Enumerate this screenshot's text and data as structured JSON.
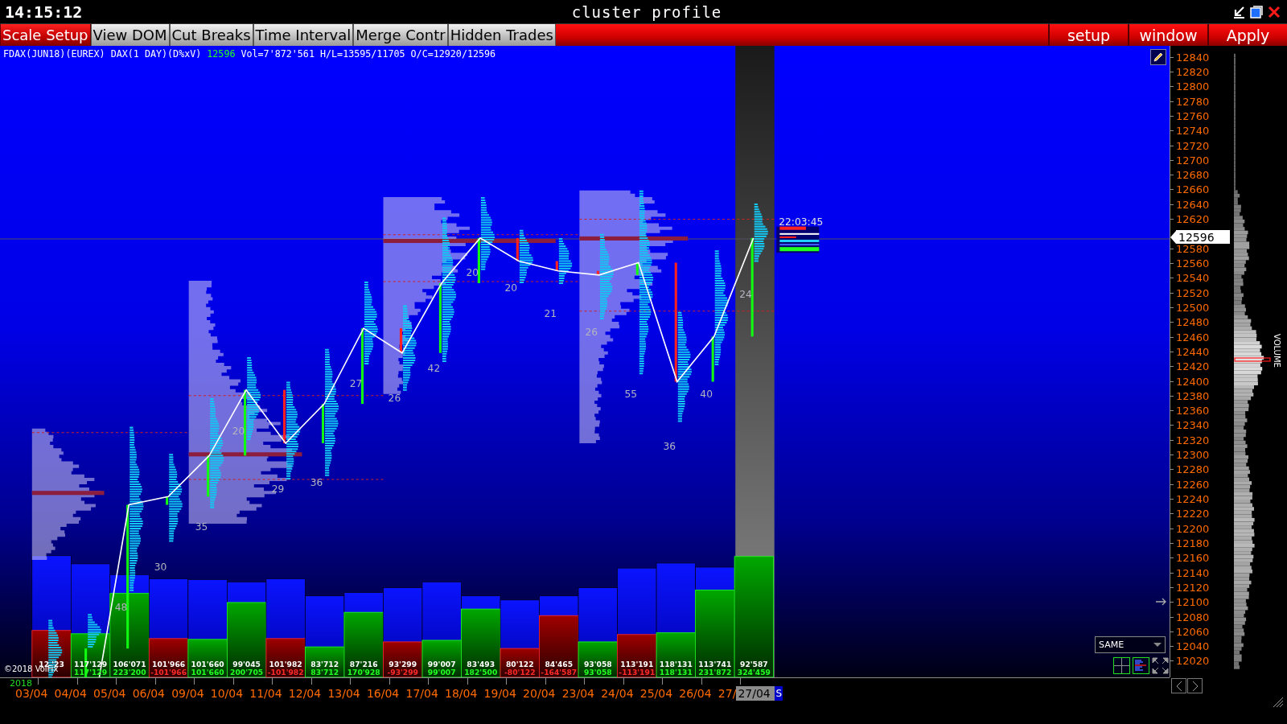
{
  "window": {
    "clock": "14:15:12",
    "title": "cluster profile"
  },
  "toolbar": {
    "left": [
      {
        "label": "Scale Setup",
        "selected": true
      },
      {
        "label": "View DOM",
        "selected": false
      },
      {
        "label": "Cut Breaks",
        "selected": false
      },
      {
        "label": "Time Interval",
        "selected": false
      },
      {
        "label": "Merge Contr",
        "selected": false
      },
      {
        "label": "Hidden Trades",
        "selected": false
      }
    ],
    "right": [
      "setup",
      "window",
      "Apply"
    ]
  },
  "chart": {
    "instrument": "FDAX(JUN18)(EUREX) DAX(1 DAY)(D%xV)",
    "last": "12596",
    "stats": "Vol=7'872'561 H/L=13595/11705 O/C=12920/12596",
    "last_time": "22:03:45",
    "copyright": "©2018 VolFix",
    "view_mode": "SAME",
    "days": [
      {
        "volume": "12 '23",
        "level": 0.925,
        "delta": {
          "negative": true,
          "level": 0.356
        }
      },
      {
        "volume": "117'129",
        "level": 0.863,
        "delta": {
          "label": "117'129",
          "negative": false,
          "level": 0.331
        }
      },
      {
        "volume": "106'071",
        "level": 0.781,
        "delta": {
          "label": "223'200",
          "negative": false,
          "level": 0.638
        },
        "cluster_label": "48"
      },
      {
        "volume": "101'966",
        "level": 0.75,
        "delta": {
          "label": "-101'966",
          "negative": true,
          "level": 0.294
        },
        "cluster_label": "30"
      },
      {
        "volume": "101'660",
        "level": 0.744,
        "delta": {
          "label": "101'660",
          "negative": false,
          "level": 0.288
        },
        "cluster_label": "35"
      },
      {
        "volume": "99'045",
        "level": 0.725,
        "delta": {
          "label": "200'705",
          "negative": false,
          "level": 0.569
        },
        "cluster_label": "20"
      },
      {
        "volume": "101'982",
        "level": 0.75,
        "delta": {
          "label": "-101'982",
          "negative": true,
          "level": 0.294
        },
        "cluster_label": "29"
      },
      {
        "volume": "83'712",
        "level": 0.619,
        "delta": {
          "label": "83'712",
          "negative": false,
          "level": 0.231
        },
        "cluster_label": "36"
      },
      {
        "volume": "87'216",
        "level": 0.644,
        "delta": {
          "label": "170'928",
          "negative": false,
          "level": 0.494
        },
        "cluster_label": "27"
      },
      {
        "volume": "93'299",
        "level": 0.681,
        "delta": {
          "label": "-93'299",
          "negative": true,
          "level": 0.269
        },
        "cluster_label": "26"
      },
      {
        "volume": "99'007",
        "level": 0.725,
        "delta": {
          "label": "99'007",
          "negative": false,
          "level": 0.281
        },
        "cluster_label": "42"
      },
      {
        "volume": "83'493",
        "level": 0.619,
        "delta": {
          "label": "182'500",
          "negative": false,
          "level": 0.519
        },
        "cluster_label": "20"
      },
      {
        "volume": "80'122",
        "level": 0.588,
        "delta": {
          "label": "-80'122",
          "negative": true,
          "level": 0.219
        },
        "cluster_label": "20"
      },
      {
        "volume": "84'465",
        "level": 0.619,
        "delta": {
          "label": "-164'587",
          "negative": true,
          "level": 0.469
        },
        "cluster_label": "21"
      },
      {
        "volume": "93'058",
        "level": 0.681,
        "delta": {
          "label": "93'058",
          "negative": false,
          "level": 0.269
        },
        "cluster_label": "26"
      },
      {
        "volume": "113'191",
        "level": 0.831,
        "delta": {
          "label": "-113'191",
          "negative": true,
          "level": 0.325
        },
        "cluster_label": "55"
      },
      {
        "volume": "118'131",
        "level": 0.869,
        "delta": {
          "label": "118'131",
          "negative": false,
          "level": 0.338
        },
        "cluster_label": "36"
      },
      {
        "volume": "113'741",
        "level": 0.838,
        "delta": {
          "label": "231'872",
          "negative": false,
          "level": 0.663
        },
        "cluster_label": "40"
      },
      {
        "volume": "92'587",
        "level": 0.681,
        "delta": {
          "label": "324'459",
          "negative": false,
          "level": 0.919
        },
        "cluster_label": "24"
      }
    ]
  },
  "price_axis": {
    "ticks_above": [
      "12840",
      "12820",
      "12800",
      "12780",
      "12760",
      "12740",
      "12720",
      "12700",
      "12680",
      "12660",
      "12640",
      "12620"
    ],
    "current_price": "12596",
    "ticks_below": [
      "12580",
      "12560",
      "12540",
      "12520",
      "12500",
      "12480",
      "12460",
      "12440",
      "12420",
      "12400",
      "12380",
      "12360",
      "12340",
      "12320",
      "12300",
      "12280",
      "12260",
      "12240",
      "12220",
      "12200",
      "12180",
      "12160",
      "12140",
      "12120",
      "12100",
      "12080",
      "12060",
      "12040",
      "12020"
    ]
  },
  "volume_profile": {
    "label": "VOLUME"
  },
  "time_axis": {
    "year": "2018",
    "dates": [
      "03/04",
      "04/04",
      "05/04",
      "06/04",
      "09/04",
      "10/04",
      "11/04",
      "12/04",
      "13/04",
      "16/04",
      "17/04",
      "18/04",
      "19/04",
      "20/04",
      "23/04",
      "24/04",
      "25/04",
      "26/04",
      "27/"
    ],
    "current_date": "27/04",
    "scroll_end": "S"
  }
}
